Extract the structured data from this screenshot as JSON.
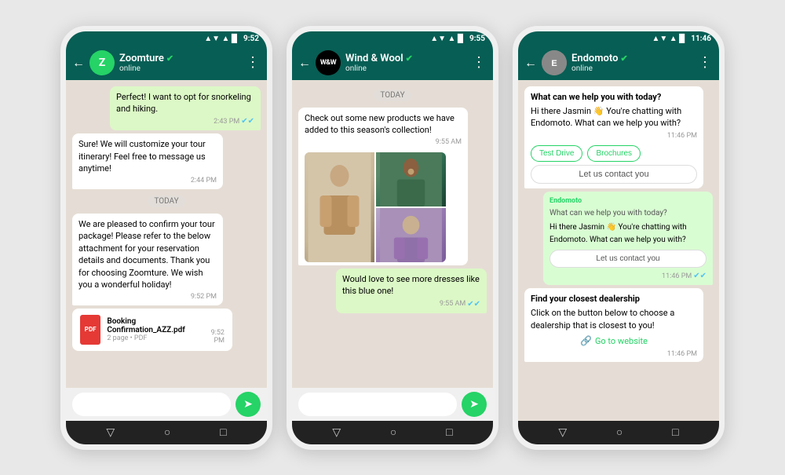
{
  "phones": [
    {
      "id": "phone1",
      "status_bar": {
        "time": "9:52",
        "signal": "▲▼",
        "wifi": "▲",
        "battery": "█"
      },
      "header": {
        "back_label": "←",
        "avatar_text": "Z",
        "avatar_class": "avatar-z",
        "name": "Zoomture",
        "verified": true,
        "status": "online",
        "menu_label": "⋮"
      },
      "messages": [
        {
          "type": "out",
          "text": "Perfect! I want to opt for snorkeling and hiking.",
          "time": "2:43 PM",
          "ticks": true
        },
        {
          "type": "in",
          "text": "Sure! We will customize your tour itinerary! Feel free to message us anytime!",
          "time": "2:44 PM"
        },
        {
          "type": "divider",
          "text": "TODAY"
        },
        {
          "type": "in",
          "text": "We are pleased to confirm your tour package! Please refer to the below attachment for your reservation details and documents. Thank you for choosing Zoomture. We wish you a wonderful holiday!",
          "time": "9:52 PM"
        },
        {
          "type": "pdf",
          "filename": "Booking Confirmation_AZZ.pdf",
          "meta": "2 page • PDF",
          "time": "9:52 PM"
        }
      ],
      "input_placeholder": ""
    },
    {
      "id": "phone2",
      "status_bar": {
        "time": "9:55"
      },
      "header": {
        "back_label": "←",
        "avatar_text": "W&W",
        "avatar_class": "avatar-ww",
        "name": "Wind & Wool",
        "verified": true,
        "status": "online",
        "menu_label": "⋮"
      },
      "messages": [
        {
          "type": "divider",
          "text": "TODAY"
        },
        {
          "type": "in_with_image",
          "text": "Check out some new products we have added to this season's collection!",
          "time": "9:55 AM"
        },
        {
          "type": "out",
          "text": "Would love to see more dresses like this blue one!",
          "time": "9:55 AM",
          "ticks": true
        }
      ],
      "input_placeholder": ""
    },
    {
      "id": "phone3",
      "status_bar": {
        "time": "11:46"
      },
      "header": {
        "back_label": "←",
        "avatar_text": "E",
        "avatar_class": "avatar-e",
        "name": "Endomoto",
        "verified": true,
        "status": "online",
        "menu_label": "⋮"
      },
      "messages": [
        {
          "type": "in_rich",
          "title": "What can we help you with today?",
          "text": "Hi there Jasmin 👋 You're chatting with Endomoto. What can we help you with?",
          "time": "11:46 PM",
          "quick_replies": [
            "Test Drive",
            "Brochures"
          ],
          "contact_btn": "Let us contact you"
        },
        {
          "type": "bot_reply",
          "sender": "Endomoto",
          "title": "What can we help you with today?",
          "text": "Hi there Jasmin 👋 You're chatting with Endomoto. What can we help you with?",
          "time": "11:46 PM",
          "ticks": true,
          "contact_btn": "Let us contact you"
        },
        {
          "type": "in_dealership",
          "title": "Find your closest dealership",
          "text": "Click on the button below to choose a dealership that is closest to you!",
          "time": "11:46 PM",
          "website_btn": "Go to website"
        }
      ],
      "quick_replies": {
        "btn1": "Test Drive",
        "btn2": "Brochures"
      },
      "contact_btn_label": "Let us contact you",
      "website_btn_label": "Go to website"
    }
  ],
  "nav": {
    "back_label": "▽",
    "home_label": "○",
    "recent_label": "□"
  }
}
